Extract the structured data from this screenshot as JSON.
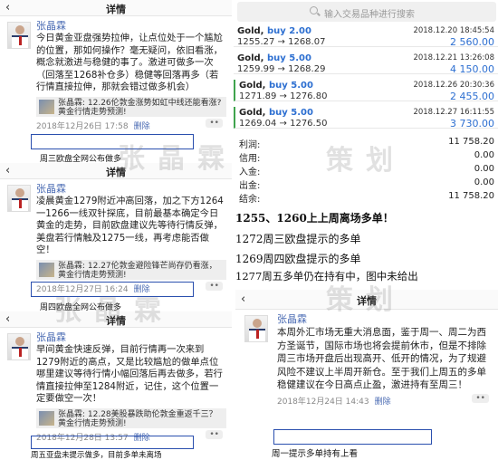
{
  "watermark": [
    "张晶霖",
    "策划"
  ],
  "panel_top_left": {
    "nav_title": "详情",
    "author": "张晶霖",
    "text": "今日黄金亚盘强势拉伸，让点位处于一个尴尬的位置，那如何操作？毫无疑问，依旧看涨，概念就激进与稳健的事了。激进可做多一次（回落至1268补仓多）稳健等回落再多（若行情直接拉伸，那就会错过做多机会）",
    "quote": "张晶霖: 12.26伦敦金涨势如虹中线还能看涨?黄金行情走势预测!",
    "date": "2018年12月26日 17:58",
    "delete": "删除",
    "dots": "••",
    "handwritten": "周三欧盘全网公布做多"
  },
  "panel_mid_left": {
    "nav_title": "详情",
    "author": "张晶霖",
    "text": "凌晨黄金1279附近冲高回落，加之下方1264一1266一线双针探底，目前最基本确定今日黄金的走势，目前欧盘建议先等待行情反弹，美盘若行情触及1275一线，再考虑能否做空！",
    "quote": "张晶霖: 12.27伦敦金避险锋芒尚存仍看涨，黄金行情走势预测!",
    "date": "2018年12月27日 16:24",
    "delete": "删除",
    "dots": "••",
    "handwritten": "周四欧盘全网公布做多"
  },
  "panel_bot_left": {
    "nav_title": "详情",
    "author": "张晶霖",
    "text": "早间黄金快速反弹，目前行情再一次来到1279附近的高点，又是比较尴尬的做单点位哪里建议等待行情小幅回落后再去做多，若行情直接拉伸至1284附近，记住，这个位置一定要做空一次！",
    "quote": "张晶霖: 12.28美股暴跌助伦敦金重返千三？黄金行情走势预测!",
    "date": "2018年12月28日 13:57",
    "delete": "删除",
    "dots": "••",
    "handwritten": "周五亚盘未提示做多，目前多单未离场"
  },
  "panel_top_right": {
    "search_placeholder": "输入交易品种进行搜索",
    "trades": [
      {
        "symbol": "Gold,",
        "action": "buy 2.00",
        "prices": "1255.27 → 1268.07",
        "datetime": "2018.12.20 18:45:54",
        "profit": "2 560.00"
      },
      {
        "symbol": "Gold,",
        "action": "buy 5.00",
        "prices": "1259.99 → 1268.29",
        "datetime": "2018.12.21 13:26:08",
        "profit": "4 150.00"
      },
      {
        "symbol": "Gold,",
        "action": "buy 5.00",
        "prices": "1271.89 → 1276.80",
        "datetime": "2018.12.26 20:30:36",
        "profit": "2 455.00"
      },
      {
        "symbol": "Gold,",
        "action": "buy 5.00",
        "prices": "1269.04 → 1276.50",
        "datetime": "2018.12.27 16:11:55",
        "profit": "3 730.00"
      }
    ],
    "summary": [
      {
        "label": "利润:",
        "value": "11 758.20"
      },
      {
        "label": "信用:",
        "value": "0.00"
      },
      {
        "label": "入金:",
        "value": "0.00"
      },
      {
        "label": "出金:",
        "value": "0.00"
      },
      {
        "label": "结余:",
        "value": "11 758.20"
      }
    ]
  },
  "handwritten_notes": [
    "1255、1260上上周离场多单！",
    "1272周三欧盘提示的多单",
    "1269周四欧盘提示的多单",
    "1277周五多单仍在持有中，图中未给出"
  ],
  "panel_bot_right": {
    "nav_title": "详情",
    "author": "张晶霖",
    "text": "本周外汇市场无重大消息面，鉴于周一、周二为西方圣诞节，国际市场也将会提前休市，但是不排除周三市场开盘后出现高开、低开的情况，为了规避风险不建议上半周开新仓。至于我们上周五的多单稳健建议在今日高点止盈，激进持有至周三！",
    "date": "2018年12月24日 14:43",
    "delete": "删除",
    "dots": "••",
    "handwritten": "周一提示多单持有上看"
  },
  "colors": {
    "accent": "#2d6fd1",
    "author": "#4a6bb3",
    "highlight": "#2a4fae",
    "trade_mark": "#3fa34d"
  }
}
